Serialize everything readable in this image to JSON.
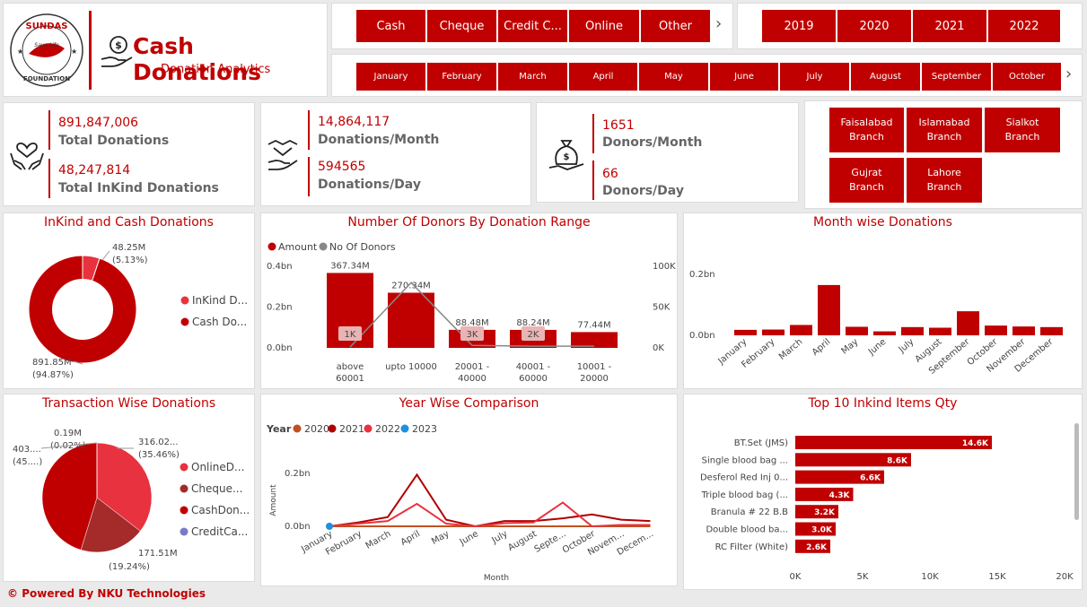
{
  "header": {
    "logo_top": "SUNDAS",
    "logo_mid": "Save Life",
    "logo_bottom": "FOUNDATION",
    "title": "Cash Donations",
    "subtitle": "Donation Analytics"
  },
  "payment_types": [
    "Cash",
    "Cheque",
    "Credit C...",
    "Online",
    "Other"
  ],
  "years": [
    "2019",
    "2020",
    "2021",
    "2022"
  ],
  "months": [
    "January",
    "February",
    "March",
    "April",
    "May",
    "June",
    "July",
    "August",
    "September",
    "October"
  ],
  "kpis": {
    "total_donations": {
      "value": "891,847,006",
      "label": "Total Donations"
    },
    "total_inkind": {
      "value": "48,247,814",
      "label": "Total InKind Donations"
    },
    "donations_month": {
      "value": "14,864,117",
      "label": "Donations/Month"
    },
    "donations_day": {
      "value": "594565",
      "label": "Donations/Day"
    },
    "donors_month": {
      "value": "1651",
      "label": "Donors/Month"
    },
    "donors_day": {
      "value": "66",
      "label": "Donors/Day"
    }
  },
  "branches": [
    {
      "line1": "Faisalabad",
      "line2": "Branch"
    },
    {
      "line1": "Islamabad",
      "line2": "Branch"
    },
    {
      "line1": "Sialkot",
      "line2": "Branch"
    },
    {
      "line1": "Gujrat",
      "line2": "Branch"
    },
    {
      "line1": "Lahore",
      "line2": "Branch"
    }
  ],
  "footer": "Powered By NKU Technologies",
  "colors": {
    "accent": "#c00000",
    "light": "#e8323f",
    "dark": "#a52a2a",
    "blue": "#3b8bd6"
  },
  "chart_data": [
    {
      "type": "pie",
      "title": "InKind and Cash Donations",
      "donut": true,
      "slices": [
        {
          "label": "InKind D...",
          "value": 48.25,
          "text": "48.25M",
          "pct": "(5.13%)",
          "color": "#e8323f"
        },
        {
          "label": "Cash Do...",
          "value": 891.85,
          "text": "891.85M",
          "pct": "(94.87%)",
          "color": "#c00000"
        }
      ]
    },
    {
      "type": "bar",
      "title": "Number Of Donors By Donation Range",
      "legend": [
        "Amount",
        "No Of Donors"
      ],
      "categories": [
        "above 60001",
        "upto 10000",
        "20001 - 40000",
        "40001 - 60000",
        "10001 - 20000"
      ],
      "cat_line1": [
        "above",
        "upto 10000",
        "20001 -",
        "40001 -",
        "10001 -"
      ],
      "cat_line2": [
        "60001",
        "",
        "40000",
        "60000",
        "20000"
      ],
      "series": [
        {
          "name": "Amount",
          "values": [
            367.34,
            270.34,
            88.48,
            88.24,
            77.44
          ],
          "labels": [
            "367.34M",
            "270.34M",
            "88.48M",
            "88.24M",
            "77.44M"
          ]
        },
        {
          "name": "No Of Donors",
          "values": [
            1000,
            80000,
            3000,
            2000,
            2000
          ],
          "labels": [
            "1K",
            "",
            "3K",
            "2K",
            ""
          ]
        }
      ],
      "y_ticks": [
        "0.4bn",
        "0.2bn",
        "0.0bn"
      ],
      "y2_ticks": [
        "100K",
        "50K",
        "0K"
      ],
      "ylim": [
        0,
        400
      ],
      "y2lim": [
        0,
        100000
      ]
    },
    {
      "type": "bar",
      "title": "Month wise Donations",
      "categories": [
        "January",
        "February",
        "March",
        "April",
        "May",
        "June",
        "July",
        "August",
        "September",
        "October",
        "November",
        "December"
      ],
      "values": [
        0.018,
        0.019,
        0.034,
        0.165,
        0.028,
        0.013,
        0.027,
        0.025,
        0.079,
        0.032,
        0.029,
        0.027
      ],
      "y_ticks": [
        "0.2bn",
        "0.0bn"
      ],
      "ylim": [
        0,
        0.2
      ]
    },
    {
      "type": "pie",
      "title": "Transaction Wise Donations",
      "slices": [
        {
          "label": "OnlineD...",
          "value": 316.02,
          "text": "316.02...",
          "pct": "(35.46%)",
          "color": "#e8323f"
        },
        {
          "label": "Cheque...",
          "value": 171.51,
          "text": "171.51M",
          "pct": "(19.24%)",
          "color": "#a52a2a"
        },
        {
          "label": "CashDon...",
          "value": 403.1,
          "text": "403....",
          "pct": "(45....)",
          "color": "#c00000"
        },
        {
          "label": "CreditCa...",
          "value": 0.19,
          "text": "0.19M",
          "pct": "(0.02%)",
          "color": "#7a7ac8"
        }
      ]
    },
    {
      "type": "line",
      "title": "Year Wise Comparison",
      "legend_title": "Year",
      "xlabel": "Month",
      "ylabel": "Amount",
      "categories": [
        "January",
        "February",
        "March",
        "April",
        "May",
        "June",
        "July",
        "August",
        "Septe...",
        "October",
        "Novem...",
        "Decem..."
      ],
      "y_ticks": [
        "0.2bn",
        "0.0bn"
      ],
      "ylim": [
        0,
        0.2
      ],
      "series": [
        {
          "name": "2020",
          "color": "#c0501f",
          "values": [
            0.0,
            0.0,
            0.0,
            0.0,
            0.0,
            0.0,
            0.0,
            0.0,
            0.0,
            0.0,
            0.0,
            0.0
          ]
        },
        {
          "name": "2021",
          "color": "#b00000",
          "values": [
            0.0,
            0.015,
            0.035,
            0.195,
            0.025,
            0.0,
            0.02,
            0.02,
            0.03,
            0.045,
            0.025,
            0.02
          ]
        },
        {
          "name": "2022",
          "color": "#e8323f",
          "values": [
            0.0,
            0.01,
            0.02,
            0.085,
            0.01,
            0.0,
            0.012,
            0.015,
            0.09,
            0.0,
            0.005,
            0.005
          ]
        },
        {
          "name": "2023",
          "color": "#1e90e0",
          "values": [
            0.0
          ]
        }
      ]
    },
    {
      "type": "bar",
      "orientation": "horizontal",
      "title": "Top 10 Inkind Items Qty",
      "categories": [
        "BT.Set (JMS)",
        "Single blood bag ...",
        "Desferol Red Inj 0...",
        "Triple blood bag (...",
        "Branula # 22 B.B",
        "Double blood ba...",
        "RC Filter (White)"
      ],
      "values": [
        14.6,
        8.6,
        6.6,
        4.3,
        3.2,
        3.0,
        2.6
      ],
      "labels": [
        "14.6K",
        "8.6K",
        "6.6K",
        "4.3K",
        "3.2K",
        "3.0K",
        "2.6K"
      ],
      "x_ticks": [
        "0K",
        "5K",
        "10K",
        "15K",
        "20K"
      ],
      "xlim": [
        0,
        20
      ]
    }
  ]
}
